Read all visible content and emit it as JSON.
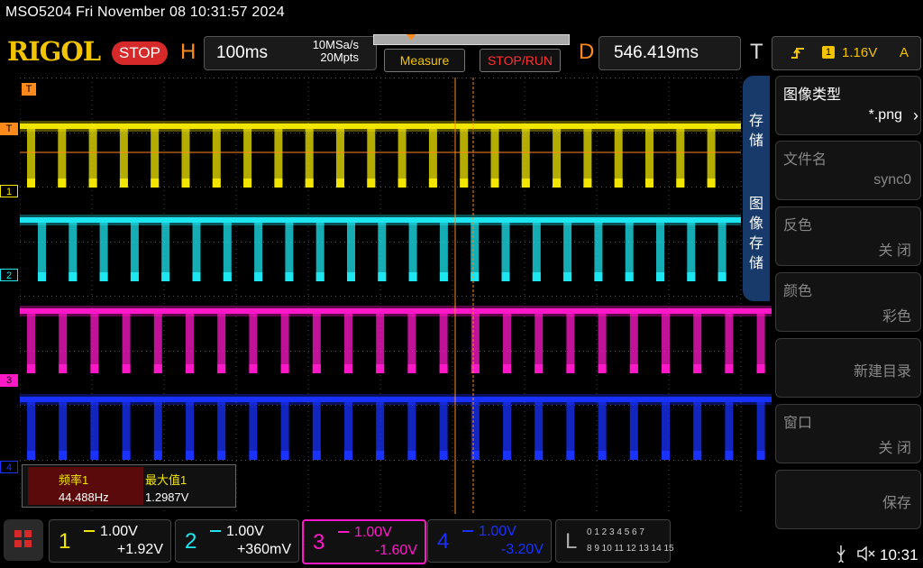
{
  "title_line": "MSO5204  Fri November 08 10:31:57 2024",
  "brand": "RIGOL",
  "run_state": "STOP",
  "horizontal": {
    "letter": "H",
    "time_base": "100ms",
    "sample_rate": "10MSa/s",
    "memory_depth": "20Mpts"
  },
  "buttons": {
    "measure": "Measure",
    "stop_run": "STOP/RUN"
  },
  "delay": {
    "letter": "D",
    "value": "546.419ms"
  },
  "trigger": {
    "letter": "T",
    "source": "1",
    "level": "1.16V",
    "mode": "A"
  },
  "side_tab": {
    "save_chars": [
      "存",
      "储"
    ],
    "image_save_chars": [
      "图",
      "像",
      "存",
      "储"
    ]
  },
  "menu": {
    "image_type_label": "图像类型",
    "image_type_value": "*.png",
    "filename_label": "文件名",
    "filename_value": "sync0",
    "invert_label": "反色",
    "invert_value": "关 闭",
    "color_label": "颜色",
    "color_value": "彩色",
    "new_dir": "新建目录",
    "window_label": "窗口",
    "window_value": "关 闭",
    "save": "保存"
  },
  "measurement": {
    "freq_label": "频率1",
    "freq_value": "44.488Hz",
    "max_label": "最大值1",
    "max_value": "1.2987V"
  },
  "channels": [
    {
      "num": "1",
      "scale": "1.00V",
      "offset": "+1.92V",
      "color": "#f2e600"
    },
    {
      "num": "2",
      "scale": "1.00V",
      "offset": "+360mV",
      "color": "#1ee6f0"
    },
    {
      "num": "3",
      "scale": "1.00V",
      "offset": "-1.60V",
      "color": "#ff18c8"
    },
    {
      "num": "4",
      "scale": "1.00V",
      "offset": "-3.20V",
      "color": "#1a32ff"
    }
  ],
  "logic": {
    "letter": "L",
    "row1": "0 1 2 3   4 5 6 7",
    "row2": "8 9 10 11  12 13 14 15"
  },
  "waveform_markers": {
    "ch1": "1",
    "ch2": "2",
    "ch3": "3",
    "ch4": "4",
    "trigger": "T"
  },
  "status_time": "10:31"
}
